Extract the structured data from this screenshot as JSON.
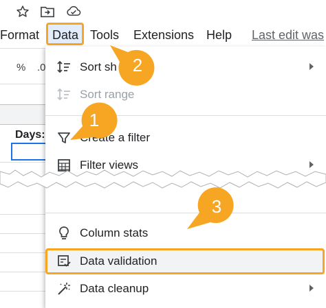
{
  "toolbar_icons": [
    "star-icon",
    "move-to-folder-icon",
    "cloud-saved-icon"
  ],
  "menubar": {
    "items": [
      "Format",
      "Data",
      "Tools",
      "Extensions",
      "Help"
    ],
    "last_edit": "Last edit was"
  },
  "format_toolbar": {
    "percent": "%",
    "decimal": ".0"
  },
  "sheet": {
    "cell_label": "Days:"
  },
  "menu": {
    "items": [
      {
        "label": "Sort sh",
        "icon": "sort-icon",
        "submenu": true,
        "disabled": false
      },
      {
        "label": "Sort range",
        "icon": "sort-icon",
        "submenu": false,
        "disabled": true
      },
      {
        "label": "Create a filter",
        "icon": "filter-icon",
        "submenu": false,
        "disabled": false
      },
      {
        "label": "Filter views",
        "icon": "filter-views-icon",
        "submenu": true,
        "disabled": false
      },
      {
        "label": "Column stats",
        "icon": "lightbulb-icon",
        "submenu": false,
        "disabled": false
      },
      {
        "label": "Data validation",
        "icon": "data-validation-icon",
        "submenu": false,
        "disabled": false
      },
      {
        "label": "Data cleanup",
        "icon": "magic-wand-icon",
        "submenu": true,
        "disabled": false
      }
    ]
  },
  "callouts": [
    "1",
    "2",
    "3"
  ],
  "colors": {
    "callout": "#f6a623",
    "highlight_border": "#f6a623",
    "data_tab_bg": "#e2ecfb",
    "selection": "#1a73e8"
  }
}
